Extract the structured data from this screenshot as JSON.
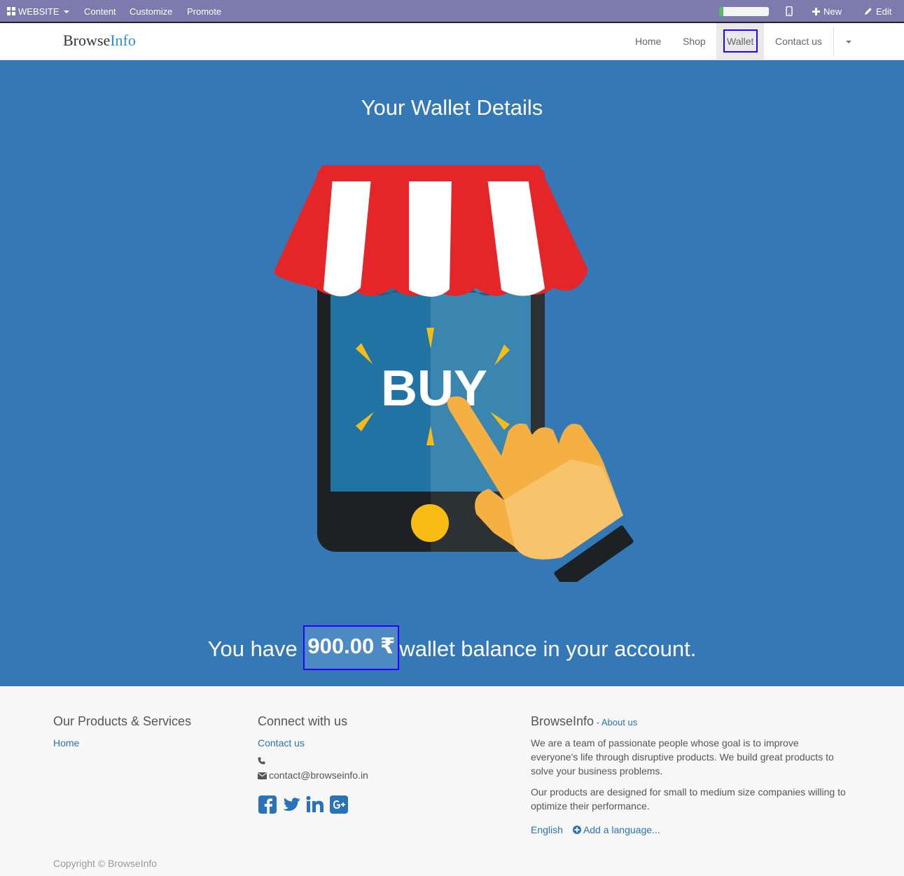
{
  "admin_bar": {
    "website_label": "WEBSITE",
    "content_label": "Content",
    "customize_label": "Customize",
    "promote_label": "Promote",
    "new_label": "New",
    "edit_label": "Edit"
  },
  "navbar": {
    "brand_part1": "Browse",
    "brand_part2": "Info",
    "items": [
      {
        "label": "Home"
      },
      {
        "label": "Shop"
      },
      {
        "label": "Wallet",
        "active": true
      },
      {
        "label": "Contact us"
      }
    ]
  },
  "hero": {
    "title": "Your Wallet Details",
    "illustration_text": "BUY",
    "balance_prefix": "You have",
    "balance_amount": "900.00 ₹",
    "balance_suffix": "wallet balance in your account."
  },
  "footer": {
    "col1_title": "Our Products & Services",
    "col1_link": "Home",
    "col2_title": "Connect with us",
    "col2_link": "Contact us",
    "email": "contact@browseinfo.in",
    "social": [
      "facebook-icon",
      "twitter-icon",
      "linkedin-icon",
      "google-plus-icon"
    ],
    "col3_title": "BrowseInfo",
    "col3_sep": " - ",
    "col3_about": "About us",
    "para1": "We are a team of passionate people whose goal is to improve everyone's life through disruptive products. We build great products to solve your business problems.",
    "para2": "Our products are designed for small to medium size companies willing to optimize their performance.",
    "lang": "English",
    "add_lang": "Add a language...",
    "copyright": "Copyright © BrowseInfo"
  },
  "colors": {
    "admin_bar": "#7d7aad",
    "hero_bg": "#3478b6",
    "link": "#2a73b7",
    "highlight": "#2a00ff"
  }
}
